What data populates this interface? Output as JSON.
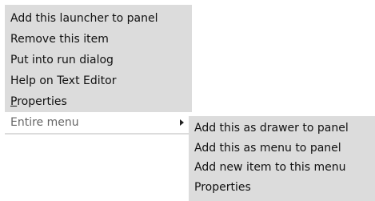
{
  "main_menu": {
    "items": [
      {
        "label": "Add this launcher to panel"
      },
      {
        "label": "Remove this item"
      },
      {
        "label": "Put into run dialog"
      },
      {
        "label": "Help on Text Editor"
      },
      {
        "label_mnemonic": "P",
        "label_rest": "roperties"
      },
      {
        "label": "Entire menu",
        "state": "highlighted",
        "has_submenu": true
      }
    ]
  },
  "sub_menu": {
    "items": [
      {
        "label": "Add this as drawer to panel"
      },
      {
        "label": "Add this as menu to panel"
      },
      {
        "label": "Add new item to this menu"
      },
      {
        "label": "Properties"
      }
    ]
  },
  "icons": {
    "submenu_arrow": "chevron-right-icon"
  },
  "colors": {
    "menu_background": "#dcdcdc",
    "highlight_background": "#ffffff",
    "highlight_text": "#666666",
    "text": "#111111"
  }
}
